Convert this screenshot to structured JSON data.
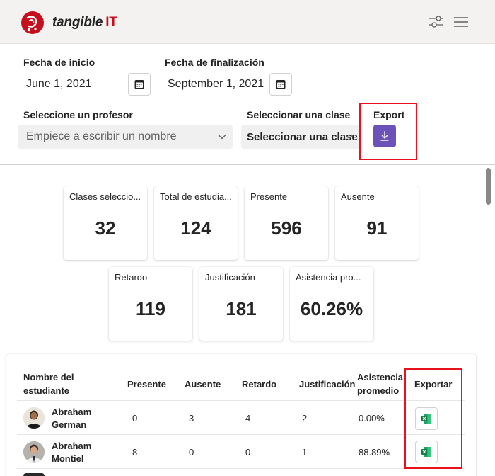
{
  "header": {
    "brand_name": "tangible",
    "brand_suffix": "IT",
    "icons": [
      "filter-settings-icon",
      "hamburger-menu-icon"
    ]
  },
  "filters": {
    "start_label": "Fecha de inicio",
    "start_value": "June 1, 2021",
    "end_label": "Fecha de finalización",
    "end_value": "September 1, 2021",
    "teacher_label": "Seleccione un profesor",
    "teacher_placeholder": "Empiece a escribir un nombre",
    "class_label": "Seleccionar una clase",
    "class_value": "Seleccionar una clase",
    "export_label": "Export"
  },
  "stats": {
    "classes": {
      "label": "Clases seleccio...",
      "value": "32"
    },
    "students": {
      "label": "Total de estudia...",
      "value": "124"
    },
    "present": {
      "label": "Presente",
      "value": "596"
    },
    "absent": {
      "label": "Ausente",
      "value": "91"
    },
    "late": {
      "label": "Retardo",
      "value": "119"
    },
    "justified": {
      "label": "Justificación",
      "value": "181"
    },
    "attendance": {
      "label": "Asistencia pro...",
      "value": "60.26%"
    }
  },
  "table": {
    "headers": {
      "name_line1": "Nombre del",
      "name_line2": "estudiante",
      "present": "Presente",
      "absent": "Ausente",
      "late": "Retardo",
      "justified": "Justificación",
      "avg_line1": "Asistencia",
      "avg_line2": "promedio",
      "export": "Exportar"
    },
    "rows": [
      {
        "first": "Abraham",
        "last": "German",
        "present": "0",
        "absent": "3",
        "late": "4",
        "justified": "2",
        "avg": "0.00%"
      },
      {
        "first": "Abraham",
        "last": "Montiel",
        "present": "8",
        "absent": "0",
        "late": "0",
        "justified": "1",
        "avg": "88.89%"
      }
    ]
  },
  "colors": {
    "brand_red": "#c50f1f",
    "accent_purple": "#6b51b8",
    "highlight_red": "#e8121c",
    "excel_green": "#107c41"
  }
}
